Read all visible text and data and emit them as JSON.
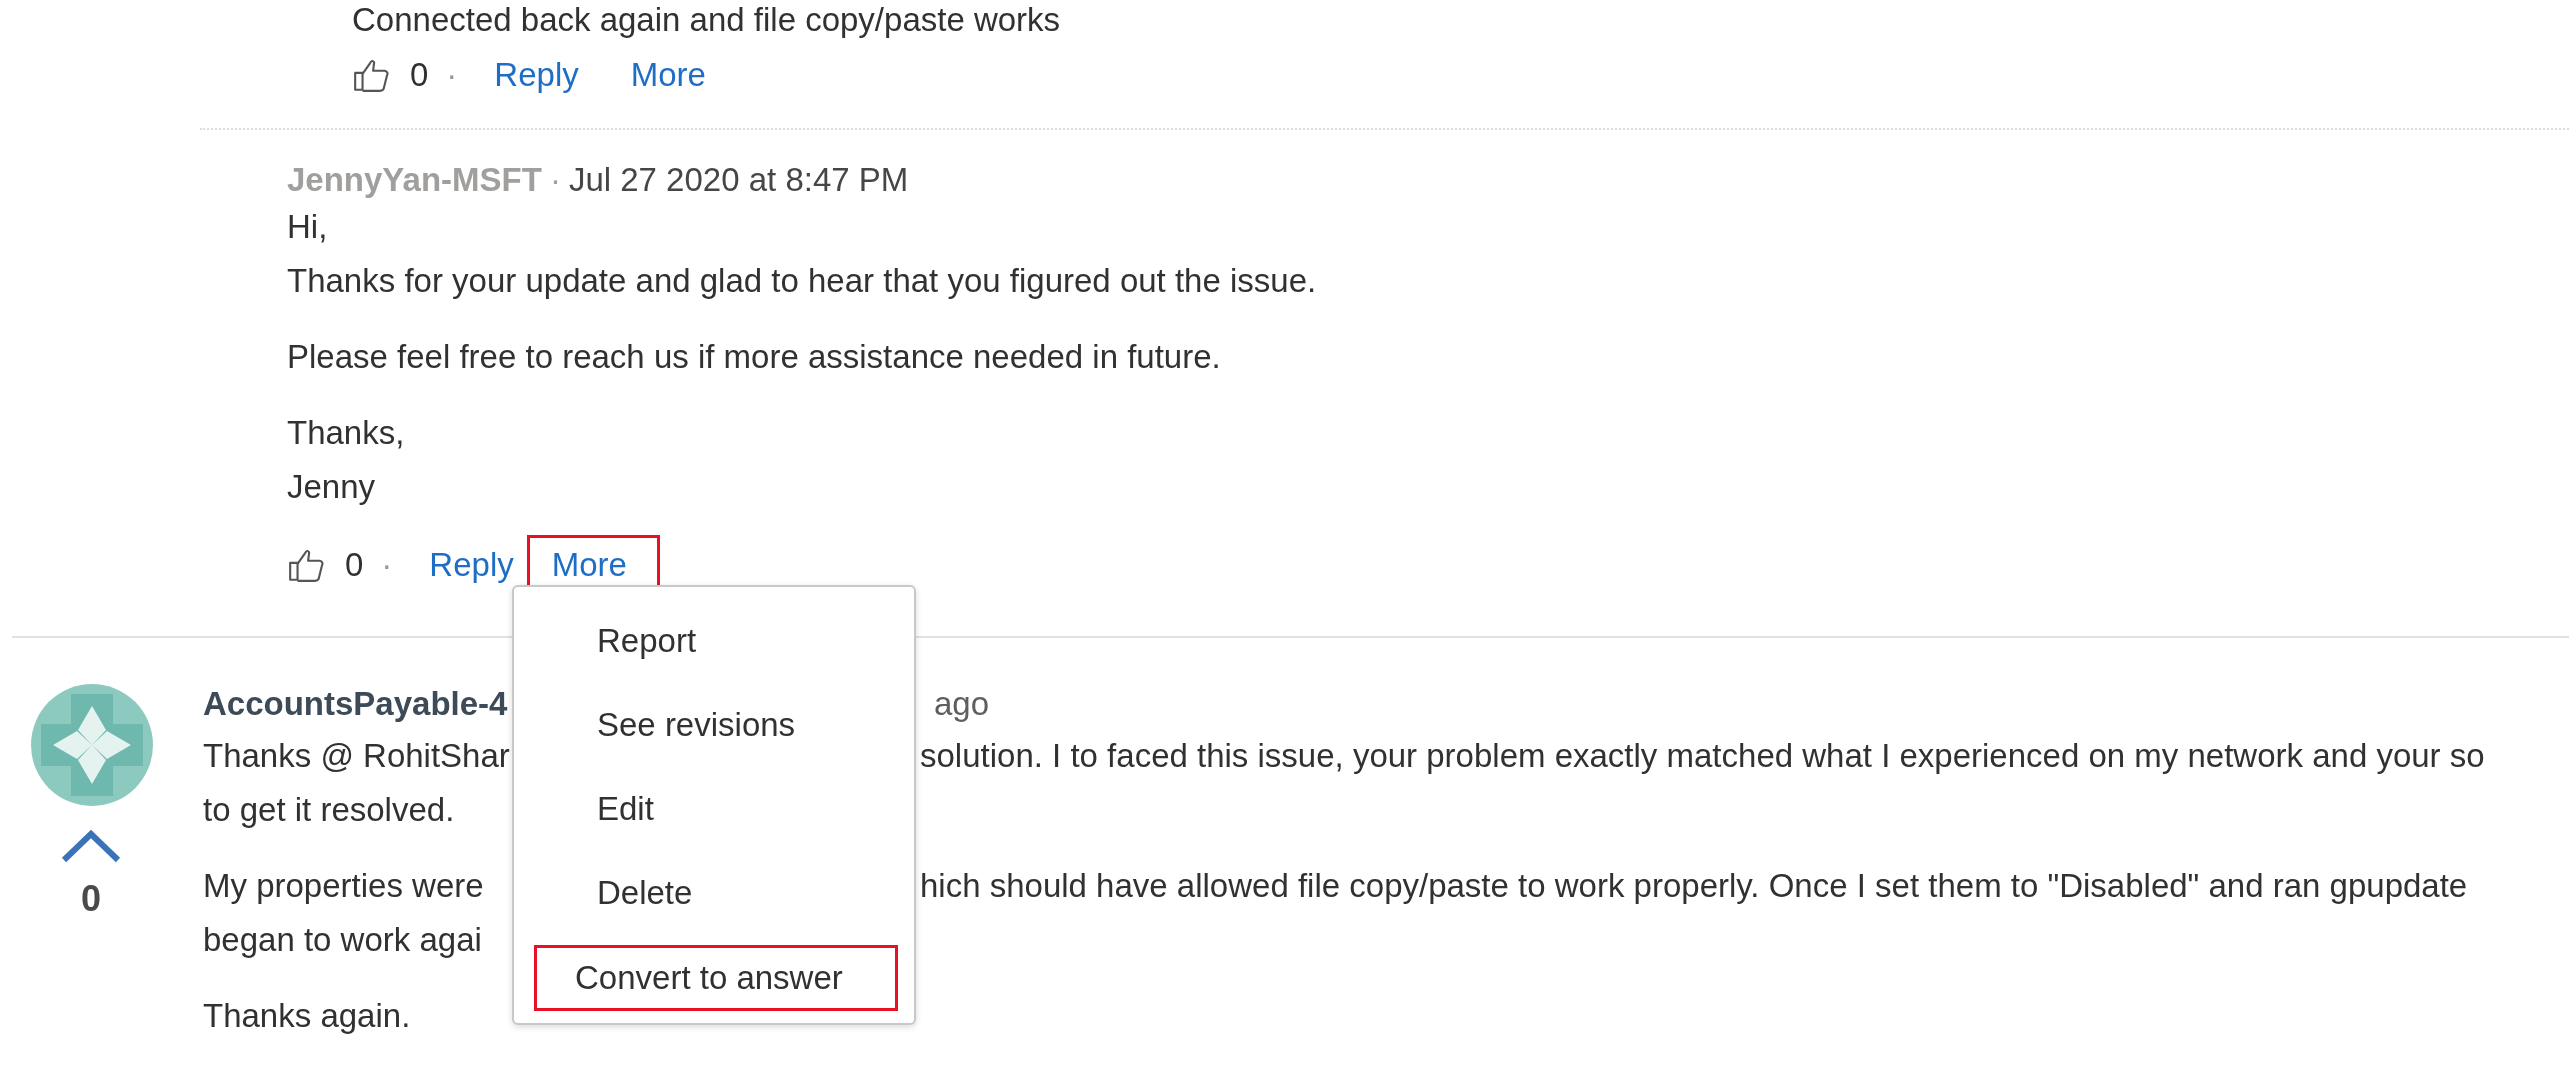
{
  "prior_reply": {
    "text": "Connected back again and file copy/paste works",
    "likes": "0",
    "separator": "·",
    "actions": [
      {
        "label": "Reply",
        "highlighted": false
      },
      {
        "label": "More",
        "highlighted": false
      }
    ]
  },
  "comment": {
    "author": "JennyYan-MSFT",
    "separator": "·",
    "date": "Jul 27 2020 at 8:47 PM",
    "paragraphs": [
      "Hi,\nThanks for your update and glad to hear that you figured out the issue.",
      "Please feel free to reach us if more assistance needed in future.",
      "Thanks,\nJenny"
    ],
    "likes": "0",
    "actions": [
      {
        "label": "Reply",
        "highlighted": false
      },
      {
        "label": "More",
        "highlighted": true
      }
    ]
  },
  "menu": {
    "items": [
      {
        "label": "Report",
        "highlighted": false
      },
      {
        "label": "See revisions",
        "highlighted": false
      },
      {
        "label": "Edit",
        "highlighted": false
      },
      {
        "label": "Delete",
        "highlighted": false
      },
      {
        "label": "Convert to answer",
        "highlighted": true
      }
    ]
  },
  "answer": {
    "author": "AccountsPayable-4",
    "time_fragment": "ago",
    "votes": "0",
    "paragraphs": [
      {
        "lines": [
          [
            "Thanks @ RohitShar",
            "solution. I to faced this issue, your problem exactly matched what I experienced on my network and your so"
          ],
          [
            "to get it resolved."
          ]
        ]
      },
      {
        "lines": [
          [
            "My properties were",
            "hich should have allowed file copy/paste to work properly. Once I set them to \"Disabled\" and ran gpupdate"
          ],
          [
            "began to work agai"
          ]
        ]
      },
      {
        "lines": [
          [
            "Thanks again."
          ]
        ]
      }
    ]
  }
}
